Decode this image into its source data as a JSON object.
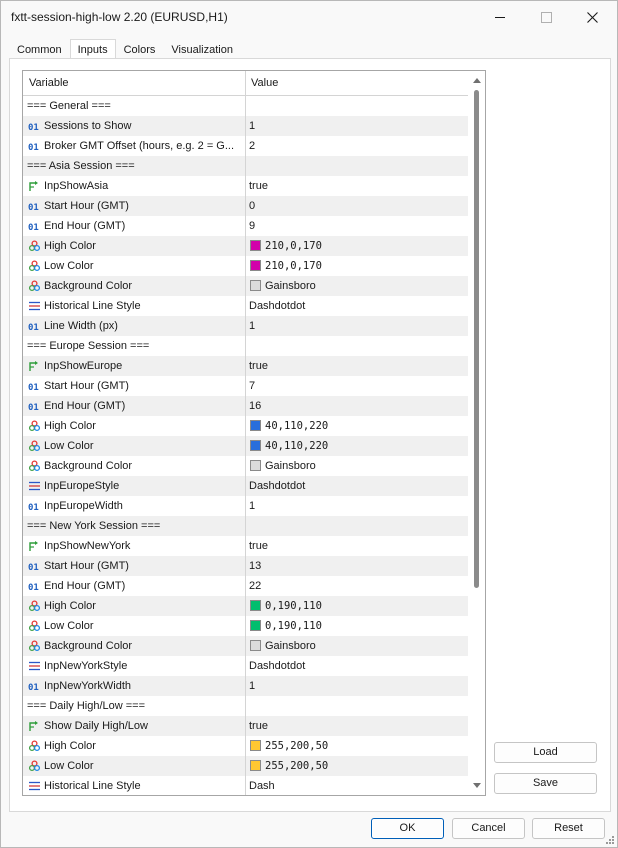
{
  "window": {
    "title": "fxtt-session-high-low 2.20 (EURUSD,H1)"
  },
  "tabs": [
    {
      "label": "Common",
      "active": false
    },
    {
      "label": "Inputs",
      "active": true
    },
    {
      "label": "Colors",
      "active": false
    },
    {
      "label": "Visualization",
      "active": false
    }
  ],
  "grid": {
    "headers": {
      "variable": "Variable",
      "value": "Value"
    },
    "rows": [
      {
        "type": "section",
        "label": "=== General ===",
        "value": ""
      },
      {
        "type": "int",
        "icon": "integer-icon",
        "label": "Sessions to Show",
        "value": "1"
      },
      {
        "type": "int",
        "icon": "integer-icon",
        "label": "Broker GMT Offset (hours, e.g. 2 = G...",
        "value": "2"
      },
      {
        "type": "section",
        "label": "=== Asia Session ===",
        "value": ""
      },
      {
        "type": "bool",
        "icon": "boolean-icon",
        "label": "InpShowAsia",
        "value": "true"
      },
      {
        "type": "int",
        "icon": "integer-icon",
        "label": "Start Hour (GMT)",
        "value": "0"
      },
      {
        "type": "int",
        "icon": "integer-icon",
        "label": "End Hour (GMT)",
        "value": "9"
      },
      {
        "type": "color",
        "icon": "color-icon",
        "label": "High Color",
        "value": "210,0,170",
        "swatch": "#d200aa"
      },
      {
        "type": "color",
        "icon": "color-icon",
        "label": "Low Color",
        "value": "210,0,170",
        "swatch": "#d200aa"
      },
      {
        "type": "color",
        "icon": "color-icon",
        "label": "Background Color",
        "value": "Gainsboro",
        "swatch": "#dcdcdc"
      },
      {
        "type": "style",
        "icon": "line-style-icon",
        "label": "Historical Line Style",
        "value": "Dashdotdot"
      },
      {
        "type": "int",
        "icon": "integer-icon",
        "label": "Line Width (px)",
        "value": "1"
      },
      {
        "type": "section",
        "label": "=== Europe Session ===",
        "value": ""
      },
      {
        "type": "bool",
        "icon": "boolean-icon",
        "label": "InpShowEurope",
        "value": "true"
      },
      {
        "type": "int",
        "icon": "integer-icon",
        "label": "Start Hour (GMT)",
        "value": "7"
      },
      {
        "type": "int",
        "icon": "integer-icon",
        "label": "End Hour (GMT)",
        "value": "16"
      },
      {
        "type": "color",
        "icon": "color-icon",
        "label": "High Color",
        "value": "40,110,220",
        "swatch": "#286edc"
      },
      {
        "type": "color",
        "icon": "color-icon",
        "label": "Low Color",
        "value": "40,110,220",
        "swatch": "#286edc"
      },
      {
        "type": "color",
        "icon": "color-icon",
        "label": "Background Color",
        "value": "Gainsboro",
        "swatch": "#dcdcdc"
      },
      {
        "type": "style",
        "icon": "line-style-icon",
        "label": "InpEuropeStyle",
        "value": "Dashdotdot"
      },
      {
        "type": "int",
        "icon": "integer-icon",
        "label": "InpEuropeWidth",
        "value": "1"
      },
      {
        "type": "section",
        "label": "=== New York Session ===",
        "value": ""
      },
      {
        "type": "bool",
        "icon": "boolean-icon",
        "label": "InpShowNewYork",
        "value": "true"
      },
      {
        "type": "int",
        "icon": "integer-icon",
        "label": "Start Hour (GMT)",
        "value": "13"
      },
      {
        "type": "int",
        "icon": "integer-icon",
        "label": "End Hour (GMT)",
        "value": "22"
      },
      {
        "type": "color",
        "icon": "color-icon",
        "label": "High Color",
        "value": "0,190,110",
        "swatch": "#00be6e"
      },
      {
        "type": "color",
        "icon": "color-icon",
        "label": "Low Color",
        "value": "0,190,110",
        "swatch": "#00be6e"
      },
      {
        "type": "color",
        "icon": "color-icon",
        "label": "Background Color",
        "value": "Gainsboro",
        "swatch": "#dcdcdc"
      },
      {
        "type": "style",
        "icon": "line-style-icon",
        "label": "InpNewYorkStyle",
        "value": "Dashdotdot"
      },
      {
        "type": "int",
        "icon": "integer-icon",
        "label": "InpNewYorkWidth",
        "value": "1"
      },
      {
        "type": "section",
        "label": "=== Daily High/Low ===",
        "value": ""
      },
      {
        "type": "bool",
        "icon": "boolean-icon",
        "label": "Show Daily High/Low",
        "value": "true"
      },
      {
        "type": "color",
        "icon": "color-icon",
        "label": "High Color",
        "value": "255,200,50",
        "swatch": "#ffc832"
      },
      {
        "type": "color",
        "icon": "color-icon",
        "label": "Low Color",
        "value": "255,200,50",
        "swatch": "#ffc832"
      },
      {
        "type": "style",
        "icon": "line-style-icon",
        "label": "Historical Line Style",
        "value": "Dash"
      }
    ]
  },
  "side_buttons": {
    "load": "Load",
    "save": "Save"
  },
  "footer": {
    "ok": "OK",
    "cancel": "Cancel",
    "reset": "Reset"
  },
  "colors": {
    "int_icon": "#1f5fbf",
    "bool_icon": "#2e9e3a",
    "style_icon": "#2b57c7",
    "color_icon": [
      "#e53935",
      "#43a047",
      "#1e88e5"
    ]
  }
}
